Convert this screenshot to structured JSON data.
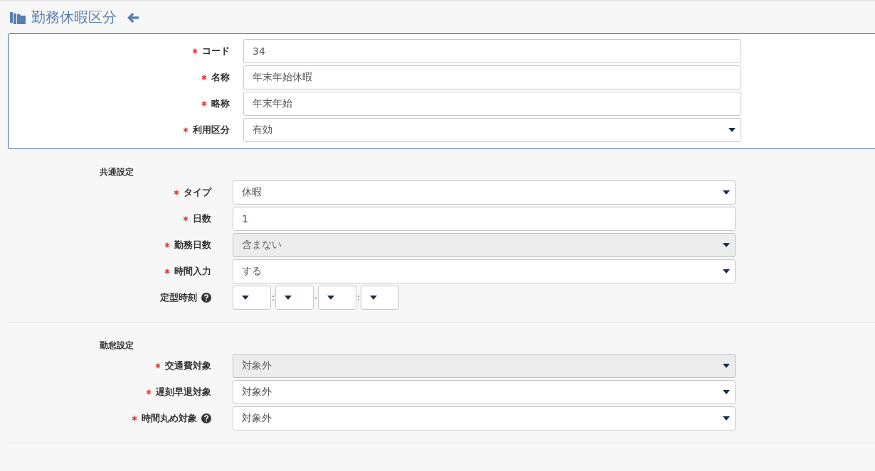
{
  "header": {
    "title": "勤務休暇区分"
  },
  "basic": {
    "fields": [
      {
        "label": "コード",
        "required": true,
        "kind": "input",
        "value": "34",
        "disabled": false
      },
      {
        "label": "名称",
        "required": true,
        "kind": "input",
        "value": "年末年始休暇",
        "disabled": false
      },
      {
        "label": "略称",
        "required": true,
        "kind": "input",
        "value": "年末年始",
        "disabled": false
      },
      {
        "label": "利用区分",
        "required": true,
        "kind": "select",
        "value": "有効",
        "disabled": false
      }
    ]
  },
  "sections": [
    {
      "heading": "共通設定",
      "fields": [
        {
          "label": "タイプ",
          "required": true,
          "kind": "select",
          "value": "休暇",
          "disabled": false
        },
        {
          "label": "日数",
          "required": true,
          "kind": "input",
          "value": "1",
          "disabled": false
        },
        {
          "label": "勤務日数",
          "required": true,
          "kind": "select",
          "value": "含まない",
          "disabled": true
        },
        {
          "label": "時間入力",
          "required": true,
          "kind": "select",
          "value": "する",
          "disabled": false
        },
        {
          "label": "定型時刻",
          "required": false,
          "help": true,
          "kind": "time",
          "separators": [
            ":",
            "-",
            ":"
          ]
        }
      ]
    },
    {
      "heading": "勤怠設定",
      "fields": [
        {
          "label": "交通費対象",
          "required": true,
          "kind": "select",
          "value": "対象外",
          "disabled": true
        },
        {
          "label": "遅刻早退対象",
          "required": true,
          "kind": "select",
          "value": "対象外",
          "disabled": false
        },
        {
          "label": "時間丸め対象",
          "required": true,
          "help": true,
          "kind": "select",
          "value": "対象外",
          "disabled": false
        }
      ]
    }
  ]
}
